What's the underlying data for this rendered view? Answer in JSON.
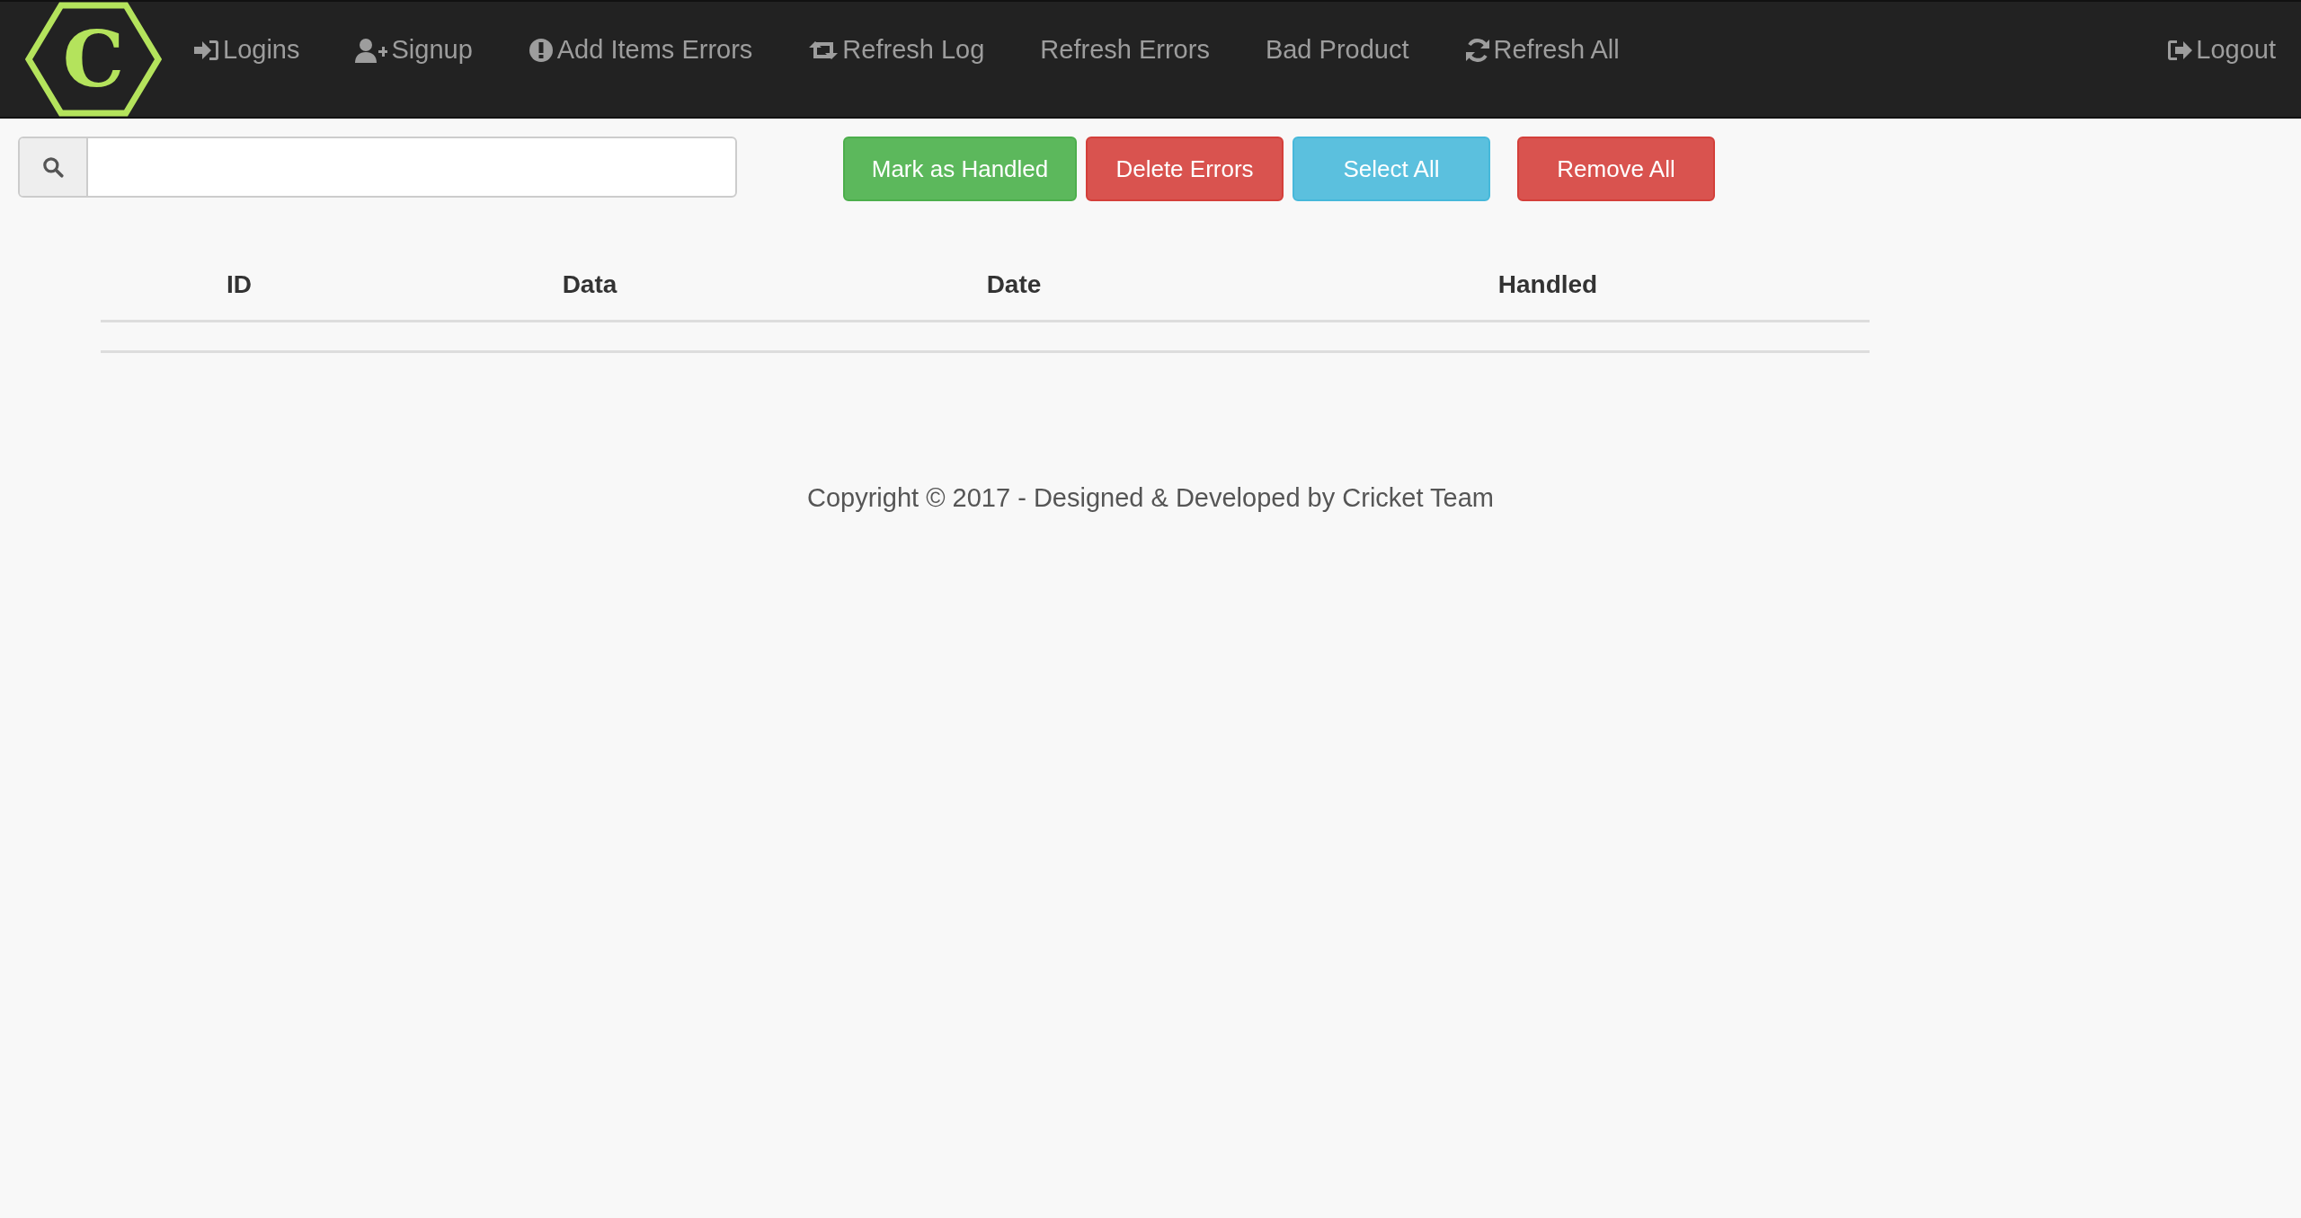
{
  "brand": {
    "letter": "C"
  },
  "nav_items": [
    {
      "label": "Logins"
    },
    {
      "label": "Signup"
    },
    {
      "label": "Add Items Errors"
    },
    {
      "label": "Refresh Log"
    },
    {
      "label": "Refresh Errors"
    },
    {
      "label": "Bad Product"
    },
    {
      "label": "Refresh All"
    }
  ],
  "nav_right": {
    "label": "Logout"
  },
  "buttons": [
    {
      "label": "Mark as Handled"
    },
    {
      "label": "Delete Errors"
    },
    {
      "label": "Select All"
    },
    {
      "label": "Remove All"
    }
  ],
  "table": {
    "columns": [
      "ID",
      "Data",
      "Date",
      "Handled"
    ]
  },
  "footer": "Copyright © 2017 - Designed & Developed by Cricket Team"
}
